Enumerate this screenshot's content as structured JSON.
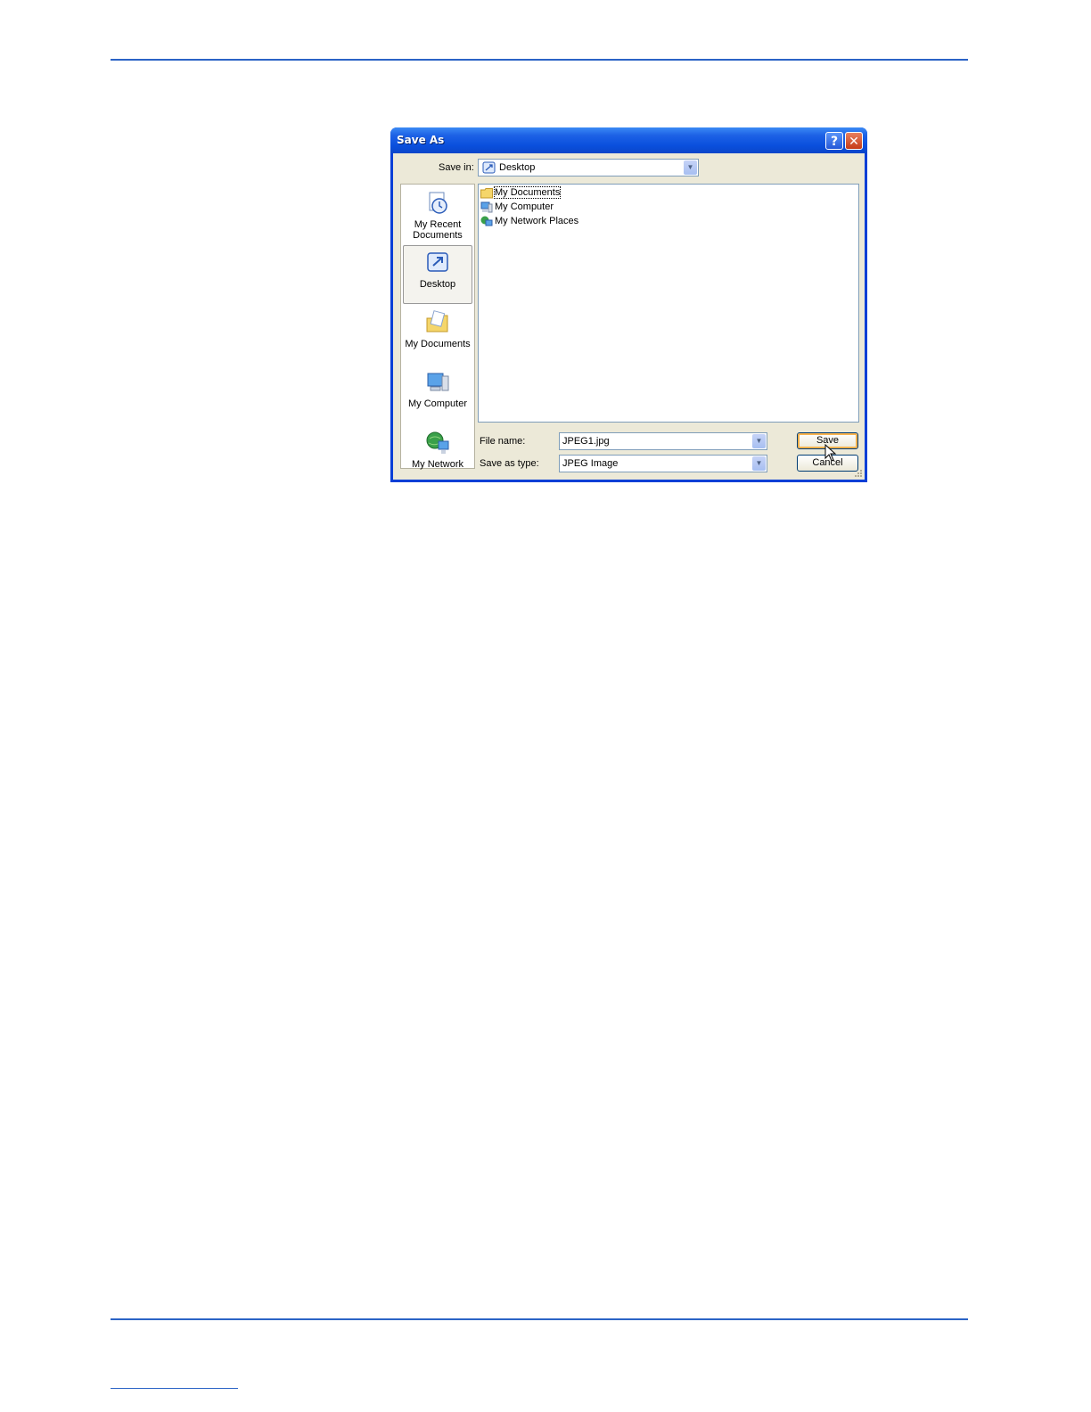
{
  "dialog": {
    "title": "Save As",
    "help_label": "?",
    "close_label": "✕"
  },
  "toolbar": {
    "save_in_label": "Save in:",
    "save_in_value": "Desktop",
    "icons": [
      "back-icon",
      "up-folder-icon",
      "new-folder-icon",
      "views-menu-icon"
    ]
  },
  "places": [
    {
      "label_1": "My Recent",
      "label_2": "Documents",
      "icon": "recent-documents-icon"
    },
    {
      "label_1": "Desktop",
      "icon": "desktop-icon",
      "selected": true
    },
    {
      "label_1": "My Documents",
      "icon": "my-documents-icon"
    },
    {
      "label_1": "My Computer",
      "icon": "my-computer-icon"
    },
    {
      "label_1": "My Network",
      "icon": "my-network-icon"
    }
  ],
  "files": [
    {
      "label": "My Documents",
      "icon": "folder-icon"
    },
    {
      "label": "My Computer",
      "icon": "computer-icon"
    },
    {
      "label": "My Network Places",
      "icon": "network-icon"
    }
  ],
  "form": {
    "file_name_label": "File name:",
    "file_name_value": "JPEG1.jpg",
    "save_type_label": "Save as type:",
    "save_type_value": "JPEG Image",
    "save_button": "Save",
    "cancel_button": "Cancel"
  },
  "colors": {
    "title_bar": "#0a4fdd",
    "dialog_face": "#ece9d8",
    "page_rule": "#2b63c6"
  }
}
